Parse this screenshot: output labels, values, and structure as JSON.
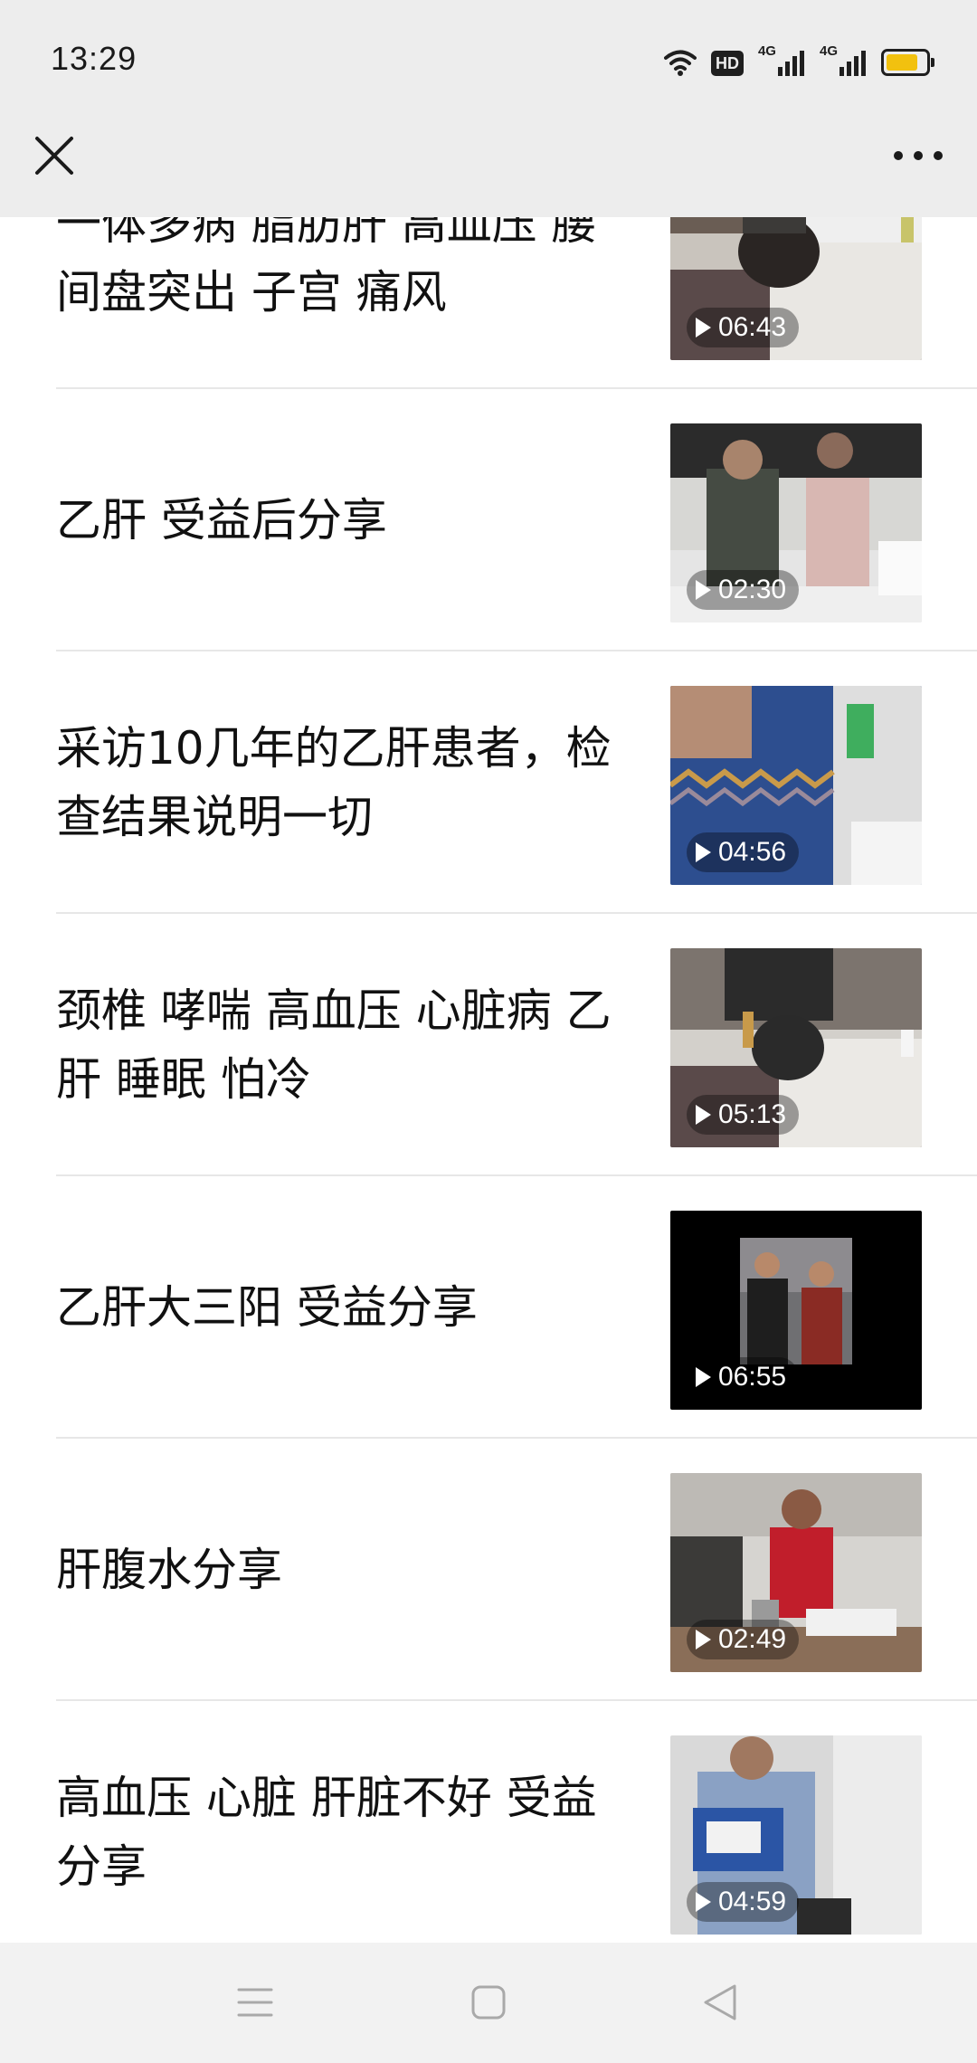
{
  "status_bar": {
    "time": "13:29",
    "hd_label": "HD",
    "network_1": "4G",
    "network_2": "4G",
    "icons": [
      "wifi-icon",
      "hd-icon",
      "signal-icon",
      "signal-icon",
      "battery-icon"
    ],
    "battery_color": "#f2c10f"
  },
  "title_bar": {
    "close_icon": "close-icon",
    "more_icon": "more-icon"
  },
  "videos": [
    {
      "title": "一体多病 脂肪肝 高血压 腰间盘突出 子宫 痛风",
      "duration": "06:43"
    },
    {
      "title": "乙肝 受益后分享",
      "duration": "02:30"
    },
    {
      "title": "采访10几年的乙肝患者，检查结果说明一切",
      "duration": "04:56"
    },
    {
      "title": "颈椎 哮喘 高血压 心脏病 乙肝 睡眠 怕冷",
      "duration": "05:13"
    },
    {
      "title": "乙肝大三阳 受益分享",
      "duration": "06:55"
    },
    {
      "title": "肝腹水分享",
      "duration": "02:49"
    },
    {
      "title": "高血压 心脏 肝脏不好 受益分享",
      "duration": "04:59"
    }
  ],
  "nav_bar": {
    "icons": [
      "menu-icon",
      "home-icon",
      "back-icon"
    ],
    "background": "#f2f2f2"
  }
}
